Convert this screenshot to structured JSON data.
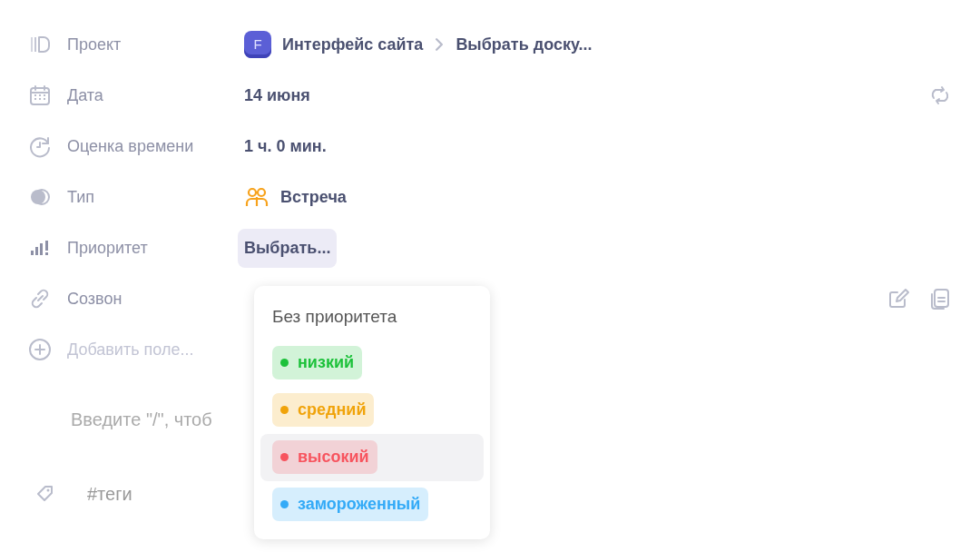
{
  "fields": [
    {
      "kind": "project",
      "label": "Проект",
      "badge": "F",
      "value": "Интерфейс сайта",
      "board": "Выбрать доску..."
    },
    {
      "kind": "date",
      "label": "Дата",
      "value": "14 июня"
    },
    {
      "kind": "estimate",
      "label": "Оценка времени",
      "value": "1 ч. 0 мин."
    },
    {
      "kind": "type",
      "label": "Тип",
      "value": "Встреча"
    },
    {
      "kind": "priority",
      "label": "Приоритет",
      "value": "Выбрать..."
    },
    {
      "kind": "link",
      "label": "Созвон"
    },
    {
      "kind": "add",
      "label": "Добавить поле..."
    }
  ],
  "description": {
    "placeholder": "Введите \"/\", чтоб"
  },
  "tags": {
    "placeholder": "#теги"
  },
  "priority_menu": {
    "none_label": "Без приоритета",
    "options": [
      {
        "label": "низкий",
        "color": "#1cc13a",
        "highlighted": false
      },
      {
        "label": "средний",
        "color": "#f0a30a",
        "highlighted": false
      },
      {
        "label": "высокий",
        "color": "#f7545e",
        "highlighted": true
      },
      {
        "label": "замороженный",
        "color": "#33aaf7",
        "highlighted": false
      }
    ]
  }
}
